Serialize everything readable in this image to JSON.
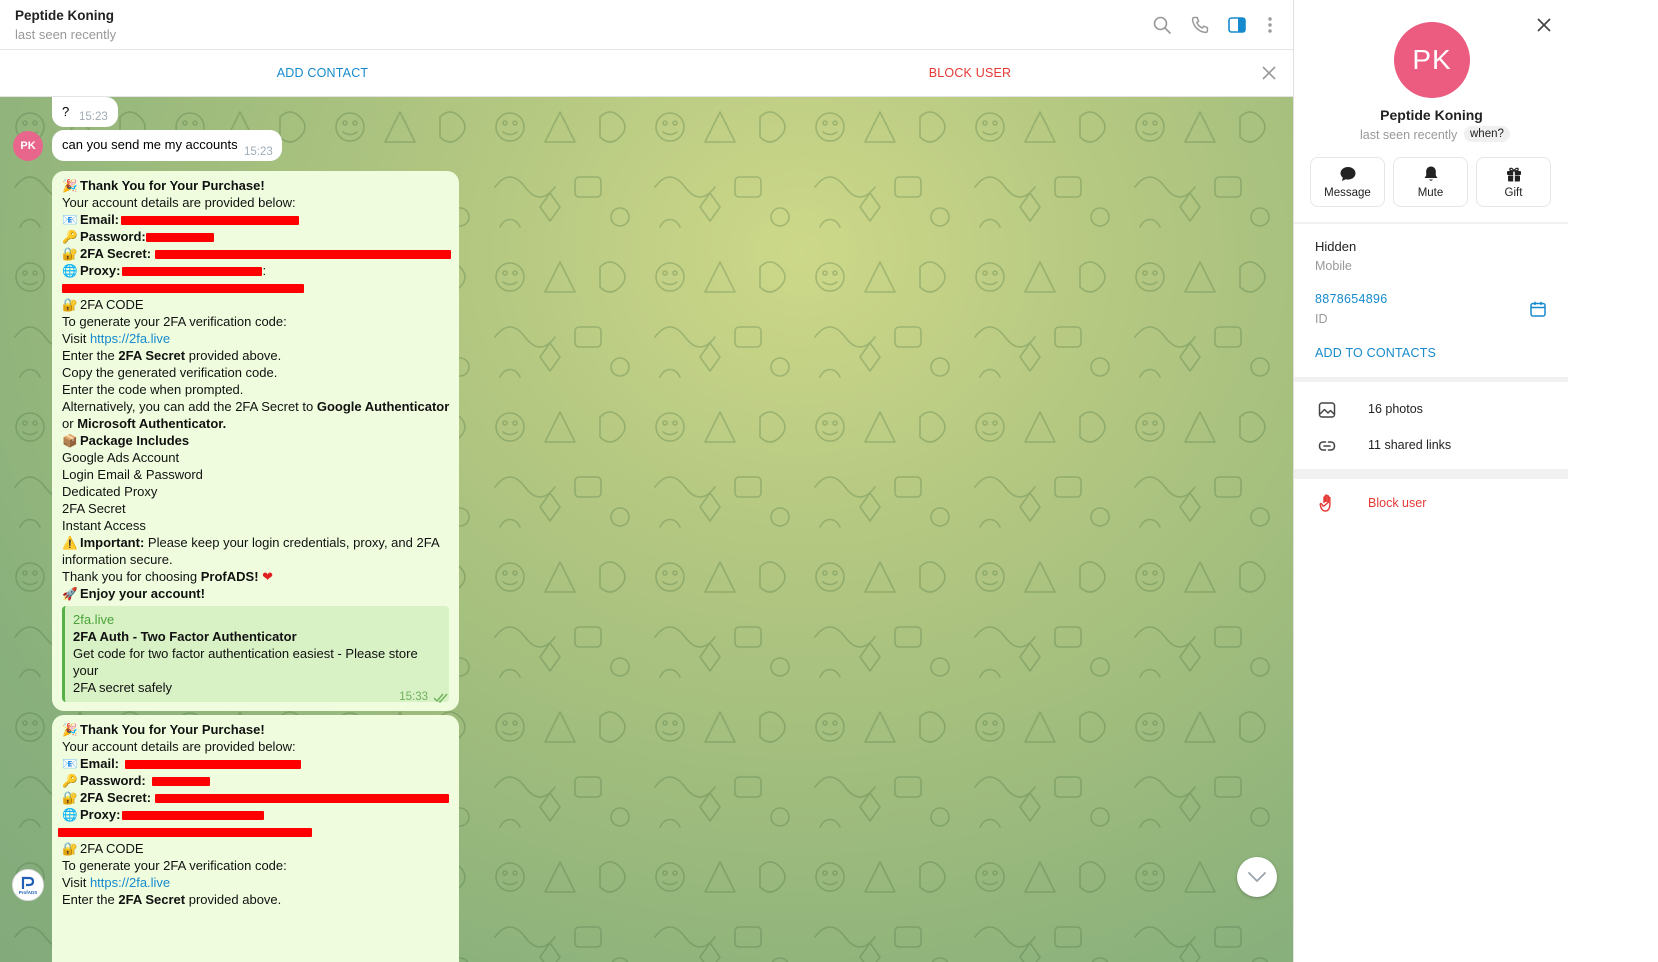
{
  "chat": {
    "title": "Peptide Koning",
    "status": "last seen recently",
    "add_contact": "ADD CONTACT",
    "block_user": "BLOCK USER"
  },
  "incoming": [
    {
      "text": "?",
      "time": "15:23"
    },
    {
      "text": "can you send me my accounts",
      "time": "15:23"
    }
  ],
  "avatar_initials": "PK",
  "receipt": {
    "title": "Thank You for Your Purchase!",
    "subtitle": "Your account details are provided below:",
    "email_label": "Email:",
    "password_label": "Password:",
    "secret_label": "2FA Secret:",
    "proxy_label": "Proxy:",
    "colon": ":",
    "code_heading": "2FA CODE",
    "gen_line": "To generate your 2FA verification code:",
    "visit": "Visit",
    "link": "https://2fa.live",
    "enter_pre": "Enter the",
    "enter_bold": "2FA Secret",
    "enter_post": "provided above.",
    "copy_line": "Copy the generated verification code.",
    "prompt_line": "Enter the code when prompted.",
    "alt_pre": "Alternatively, you can add the 2FA Secret to",
    "alt_bold1": "Google Authenticator",
    "alt_or": "or",
    "alt_bold2": "Microsoft Authenticator.",
    "package_heading": "Package Includes",
    "package_items": [
      "Google Ads Account",
      "Login Email & Password",
      "Dedicated Proxy",
      "2FA Secret",
      "Instant Access"
    ],
    "important_label": "Important:",
    "important_text1": "Please keep your login credentials, proxy, and 2FA",
    "important_text2": "information secure.",
    "thanks_pre": "Thank you for choosing",
    "thanks_bold": "ProfADS!",
    "enjoy": "Enjoy your account!",
    "preview": {
      "site": "2fa.live",
      "title": "2FA Auth - Two Factor Authenticator",
      "desc1": "Get code for two factor authentication easiest - Please store your",
      "desc2": "2FA secret safely"
    },
    "time": "15:33"
  },
  "logo_text": "ProfADS",
  "panel": {
    "initials": "PK",
    "name": "Peptide Koning",
    "status": "last seen recently",
    "when": "when?",
    "buttons": {
      "message": "Message",
      "mute": "Mute",
      "gift": "Gift"
    },
    "phone_value": "Hidden",
    "phone_label": "Mobile",
    "id_value": "8878654896",
    "id_label": "ID",
    "add_to_contacts": "ADD TO CONTACTS",
    "photos": "16 photos",
    "links": "11 shared links",
    "block": "Block user"
  },
  "colors": {
    "accent": "#168acd",
    "danger": "#e53935",
    "bubble_out": "#effdde",
    "avatar": "#ec5b80"
  }
}
